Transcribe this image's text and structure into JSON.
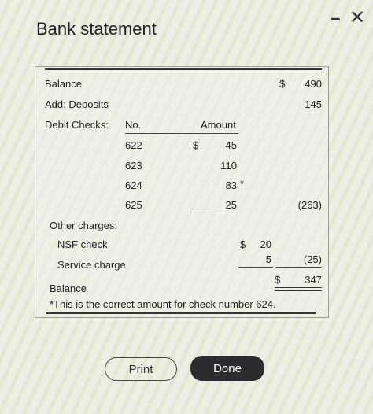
{
  "window": {
    "title": "Bank statement",
    "minimize_label": "–",
    "close_label": "✕"
  },
  "statement": {
    "balance_label": "Balance",
    "dollar_sign": "$",
    "balance_amount": "490",
    "deposits_label": "Add: Deposits",
    "deposits_amount": "145",
    "debit_checks_label": "Debit Checks:",
    "col_no": "No.",
    "col_amount": "Amount",
    "checks": [
      {
        "no": "622",
        "dollar": "$",
        "amount": "45",
        "note": ""
      },
      {
        "no": "623",
        "dollar": "",
        "amount": "110",
        "note": ""
      },
      {
        "no": "624",
        "dollar": "",
        "amount": "83",
        "note": "*"
      },
      {
        "no": "625",
        "dollar": "",
        "amount": "25",
        "note": ""
      }
    ],
    "checks_total": "(263)",
    "other_charges_label": "Other charges:",
    "nsf_label": "NSF check",
    "nsf_dollar": "$",
    "nsf_amount": "20",
    "service_label": "Service charge",
    "service_amount": "5",
    "other_total": "(25)",
    "ending_balance_label": "Balance",
    "ending_dollar": "$",
    "ending_balance": "347",
    "footnote": "*This is the correct amount for check number 624."
  },
  "buttons": {
    "print_label": "Print",
    "done_label": "Done"
  }
}
